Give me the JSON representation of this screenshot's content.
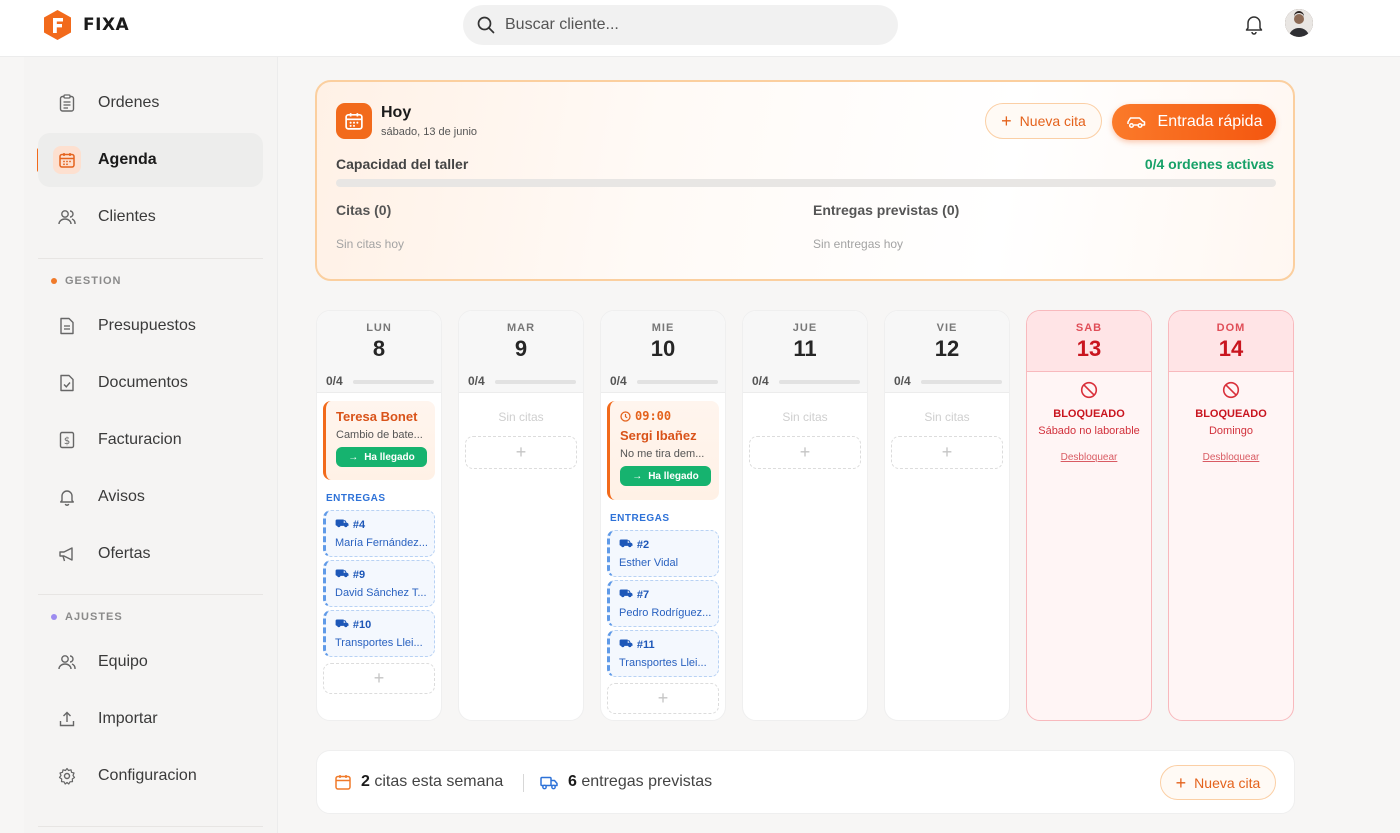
{
  "app": {
    "name": "FIXA"
  },
  "search": {
    "placeholder": "Buscar cliente..."
  },
  "sidebar": {
    "items": [
      {
        "label": "Ordenes",
        "icon": "clipboard-icon"
      },
      {
        "label": "Agenda",
        "icon": "calendar-icon",
        "active": true
      },
      {
        "label": "Clientes",
        "icon": "users-icon"
      }
    ],
    "sections": [
      {
        "label": "GESTION",
        "color": "#f07a2a",
        "items": [
          {
            "label": "Presupuestos",
            "icon": "document-icon"
          },
          {
            "label": "Documentos",
            "icon": "file-check-icon"
          },
          {
            "label": "Facturacion",
            "icon": "invoice-icon"
          },
          {
            "label": "Avisos",
            "icon": "bell-icon"
          },
          {
            "label": "Ofertas",
            "icon": "megaphone-icon"
          }
        ]
      },
      {
        "label": "AJUSTES",
        "color": "#9d8cf0",
        "items": [
          {
            "label": "Equipo",
            "icon": "users-icon"
          },
          {
            "label": "Importar",
            "icon": "upload-icon"
          },
          {
            "label": "Configuracion",
            "icon": "gear-icon"
          }
        ]
      }
    ]
  },
  "today": {
    "title": "Hoy",
    "date": "sábado, 13 de junio",
    "new_appt_label": "Nueva cita",
    "quick_entry_label": "Entrada rápida",
    "capacity_label": "Capacidad del taller",
    "capacity_value": "0/4 ordenes activas",
    "capacity_fraction": 0,
    "appts_title": "Citas (0)",
    "appts_empty": "Sin citas hoy",
    "deliveries_title": "Entregas previstas (0)",
    "deliveries_empty": "Sin entregas hoy"
  },
  "week": {
    "days": [
      {
        "name": "LUN",
        "num": "8",
        "cap": "0/4"
      },
      {
        "name": "MAR",
        "num": "9",
        "cap": "0/4",
        "empty": "Sin citas"
      },
      {
        "name": "MIE",
        "num": "10",
        "cap": "0/4"
      },
      {
        "name": "JUE",
        "num": "11",
        "cap": "0/4",
        "empty": "Sin citas"
      },
      {
        "name": "VIE",
        "num": "12",
        "cap": "0/4",
        "empty": "Sin citas"
      },
      {
        "name": "SAB",
        "num": "13",
        "blocked": "BLOQUEADO",
        "reason": "Sábado no laborable",
        "unlock": "Desbloquear"
      },
      {
        "name": "DOM",
        "num": "14",
        "blocked": "BLOQUEADO",
        "reason": "Domingo",
        "unlock": "Desbloquear"
      }
    ],
    "mon": {
      "appt": {
        "name": "Teresa Bonet",
        "desc": "Cambio de bate...",
        "status": "Ha llegado"
      },
      "deliveries_label": "ENTREGAS",
      "deliveries": [
        {
          "id": "#4",
          "name": "María Fernández..."
        },
        {
          "id": "#9",
          "name": "David Sánchez T..."
        },
        {
          "id": "#10",
          "name": "Transportes Llei..."
        }
      ]
    },
    "wed": {
      "appt": {
        "time": "09:00",
        "name": "Sergi Ibañez",
        "desc": "No me tira dem...",
        "status": "Ha llegado"
      },
      "deliveries_label": "ENTREGAS",
      "deliveries": [
        {
          "id": "#2",
          "name": "Esther Vidal"
        },
        {
          "id": "#7",
          "name": "Pedro Rodríguez..."
        },
        {
          "id": "#11",
          "name": "Transportes Llei..."
        }
      ]
    }
  },
  "summary": {
    "appts_count": "2",
    "appts_text": "citas esta semana",
    "deliveries_count": "6",
    "deliveries_text": "entregas previstas",
    "new_appt_label": "Nueva cita"
  },
  "colors": {
    "accent": "#f26a1b",
    "success": "#16b36f",
    "blocked": "#c9151f",
    "delivery": "#2e72d8"
  }
}
